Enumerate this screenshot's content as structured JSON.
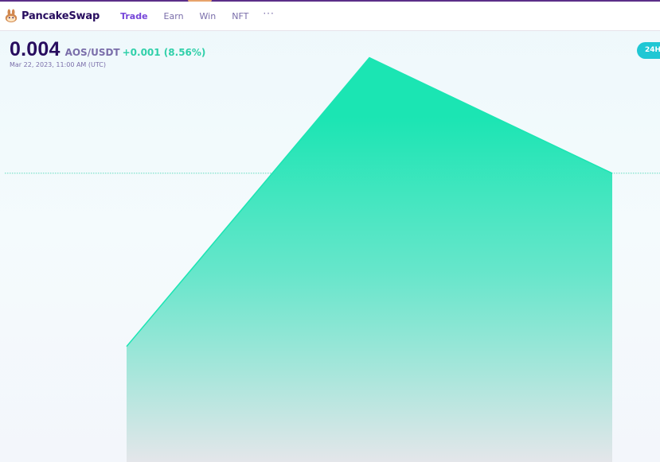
{
  "navbar": {
    "brand": "PancakeSwap",
    "items": [
      {
        "label": "Trade",
        "active": true
      },
      {
        "label": "Earn",
        "active": false
      },
      {
        "label": "Win",
        "active": false
      },
      {
        "label": "NFT",
        "active": false
      }
    ],
    "more_label": "···"
  },
  "price_header": {
    "price": "0.004",
    "pair": "AOS/USDT",
    "change": "+0.001 (8.56%)",
    "timestamp": "Mar 22, 2023, 11:00 AM (UTC)"
  },
  "range_selector": {
    "selected": "24H"
  },
  "colors": {
    "accent": "#7645d9",
    "primary_text": "#280d5f",
    "secondary_text": "#7a6eaa",
    "success": "#31d0aa",
    "area_line": "#1be5b3",
    "range_button": "#1fc7d4"
  },
  "chart_data": {
    "type": "area",
    "title": "",
    "xlabel": "",
    "ylabel": "",
    "x": [
      0,
      1,
      2
    ],
    "values": [
      0.0037,
      0.0042,
      0.004
    ],
    "ylim": [
      0.0035,
      0.0043
    ],
    "reference_line": 0.004,
    "grid": false,
    "axes_visible": false,
    "legend": "none"
  }
}
